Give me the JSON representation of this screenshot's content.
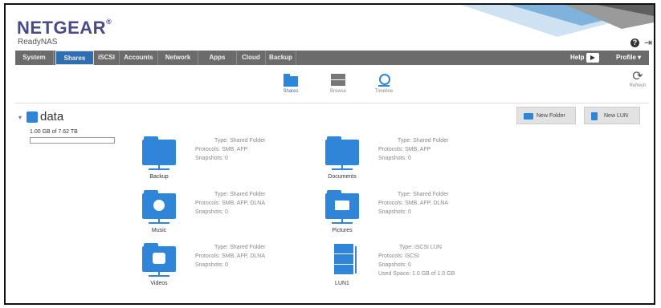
{
  "brand": {
    "logo": "NETGEAR",
    "logo_mark": "®",
    "product": "ReadyNAS"
  },
  "header": {
    "help_icon": "?",
    "logout_icon": "⇥"
  },
  "nav": {
    "tabs": [
      "System",
      "Shares",
      "iSCSI",
      "Accounts",
      "Network",
      "Apps",
      "Cloud",
      "Backup"
    ],
    "active_tab": "Shares",
    "help_label": "Help",
    "profile_label": "Profile ▾"
  },
  "subnav": [
    {
      "label": "Shares",
      "icon": "folder-icon"
    },
    {
      "label": "Browse",
      "icon": "browse-icon"
    },
    {
      "label": "Timeline",
      "icon": "clock-icon"
    }
  ],
  "refresh_label": "Refresh",
  "volume": {
    "name": "data",
    "capacity_text": "1.00 GB of 7.62 TB",
    "used_fraction": 0.0001
  },
  "buttons": {
    "new_folder": "New Folder",
    "new_lun": "New LUN"
  },
  "shares": [
    {
      "name": "Backup",
      "icon": "folder-icon",
      "type": "Type: Shared Folder",
      "protocols": "Protocols: SMB, AFP",
      "snapshots": "Snapshots: 0"
    },
    {
      "name": "Documents",
      "icon": "folder-icon",
      "type": "Type: Shared Folder",
      "protocols": "Protocols: SMB, AFP",
      "snapshots": "Snapshots: 0"
    },
    {
      "name": "Music",
      "icon": "music-folder-icon",
      "type": "Type: Shared Folder",
      "protocols": "Protocols: SMB, AFP, DLNA",
      "snapshots": "Snapshots: 0"
    },
    {
      "name": "Pictures",
      "icon": "pictures-folder-icon",
      "type": "Type: Shared Folder",
      "protocols": "Protocols: SMB, AFP, DLNA",
      "snapshots": "Snapshots: 0"
    },
    {
      "name": "Videos",
      "icon": "videos-folder-icon",
      "type": "Type: Shared Folder",
      "protocols": "Protocols: SMB, AFP, DLNA",
      "snapshots": "Snapshots: 0"
    },
    {
      "name": "LUN1",
      "icon": "lun-icon",
      "type": "Type: iSCSI LUN",
      "protocols": "Protocols: iSCSI",
      "snapshots": "Snapshots: 0",
      "used_space": "Used Space: 1.0 GB of 1.0 GB"
    }
  ],
  "colors": {
    "accent": "#2f86d8",
    "navbar": "#6b6b6b",
    "active_tab": "#2f6fb0",
    "logo": "#4a4a8a"
  }
}
